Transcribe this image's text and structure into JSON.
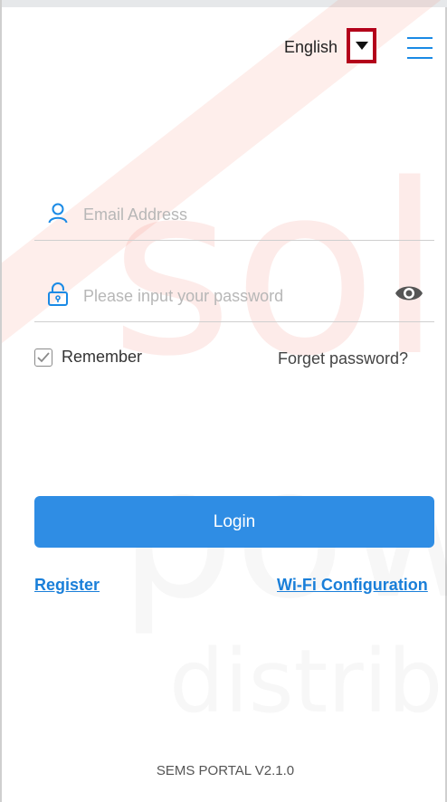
{
  "header": {
    "language": "English",
    "language_dropdown_icon": "caret-down-icon",
    "menu_icon": "hamburger-menu-icon"
  },
  "form": {
    "email_placeholder": "Email Address",
    "password_placeholder": "Please input your password",
    "remember_label": "Remember",
    "remember_checked": true,
    "forget_label": "Forget password?",
    "login_label": "Login"
  },
  "links": {
    "register": "Register",
    "wifi": "Wi-Fi Configuration"
  },
  "footer": {
    "version": "SEMS PORTAL V2.1.0"
  },
  "colors": {
    "accent": "#2f8de4",
    "link": "#1a7fd9",
    "highlight_border": "#b3001a"
  }
}
